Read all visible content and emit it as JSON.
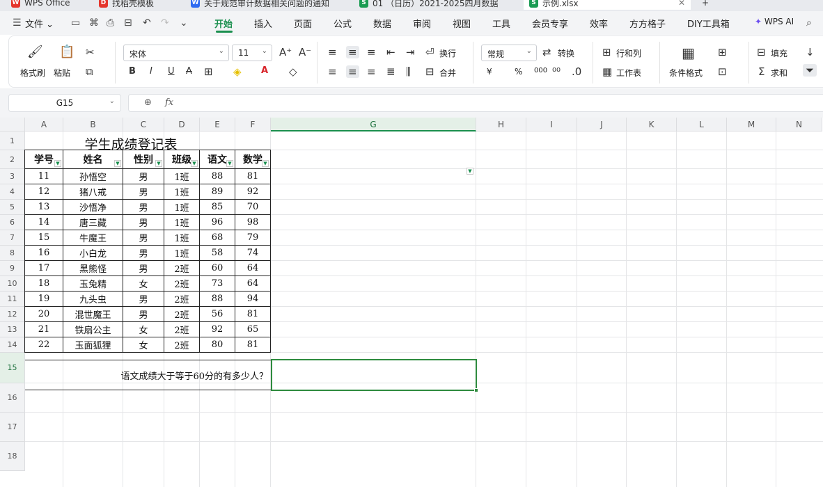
{
  "tabs": [
    {
      "label": "WPS Office",
      "icon": "W",
      "color": "#e5352c"
    },
    {
      "label": "找稻壳模板",
      "icon": "D",
      "color": "#e5352c"
    },
    {
      "label": "关于规范审计数据相关问题的通知",
      "icon": "W",
      "color": "#2f6bf1"
    },
    {
      "label": "01 （日历）2021-2025四月数据",
      "icon": "S",
      "color": "#1a9b52"
    },
    {
      "label": "示例.xlsx",
      "icon": "S",
      "color": "#1a9b52"
    }
  ],
  "menu": {
    "file_label": "文件",
    "items": [
      "开始",
      "插入",
      "页面",
      "公式",
      "数据",
      "审阅",
      "视图",
      "工具",
      "会员专享",
      "效率",
      "方方格子",
      "DIY工具箱"
    ],
    "active": "开始",
    "ai_label": "WPS AI"
  },
  "ribbon": {
    "format_painter": "格式刷",
    "paste": "粘贴",
    "font_name": "宋体",
    "font_size": "11",
    "bold": "B",
    "italic": "I",
    "underline": "U",
    "strike": "A",
    "wrap": "换行",
    "merge": "合并",
    "number_format": "常规",
    "convert": "转换",
    "currency": "¥",
    "percent": "%",
    "thousands": "000",
    "rows_cols": "行和列",
    "worksheet": "工作表",
    "conditional_format": "条件格式",
    "fill": "填充",
    "sum": "求和"
  },
  "formula_bar": {
    "name_box": "G15",
    "fx_label": "fx",
    "formula": ""
  },
  "grid": {
    "columns": [
      "A",
      "B",
      "C",
      "D",
      "E",
      "F",
      "G",
      "H",
      "I",
      "J",
      "K",
      "L",
      "M",
      "N"
    ],
    "selected_column": "G",
    "rows": [
      "1",
      "2",
      "3",
      "4",
      "5",
      "6",
      "7",
      "8",
      "9",
      "10",
      "11",
      "12",
      "13",
      "14",
      "15",
      "16",
      "17",
      "18"
    ],
    "selected_row": "15"
  },
  "sheet": {
    "title": "学生成绩登记表",
    "headers": [
      "学号",
      "姓名",
      "性别",
      "班级",
      "语文",
      "数学"
    ],
    "data": [
      [
        "11",
        "孙悟空",
        "男",
        "1班",
        "88",
        "81"
      ],
      [
        "12",
        "猪八戒",
        "男",
        "1班",
        "89",
        "92"
      ],
      [
        "13",
        "沙悟净",
        "男",
        "1班",
        "85",
        "70"
      ],
      [
        "14",
        "唐三藏",
        "男",
        "1班",
        "96",
        "98"
      ],
      [
        "15",
        "牛魔王",
        "男",
        "1班",
        "68",
        "79"
      ],
      [
        "16",
        "小白龙",
        "男",
        "1班",
        "58",
        "74"
      ],
      [
        "17",
        "黑熊怪",
        "男",
        "2班",
        "60",
        "64"
      ],
      [
        "18",
        "玉兔精",
        "女",
        "2班",
        "73",
        "64"
      ],
      [
        "19",
        "九头虫",
        "男",
        "2班",
        "88",
        "94"
      ],
      [
        "20",
        "混世魔王",
        "男",
        "2班",
        "56",
        "81"
      ],
      [
        "21",
        "铁扇公主",
        "女",
        "2班",
        "92",
        "65"
      ],
      [
        "22",
        "玉面狐狸",
        "女",
        "2班",
        "80",
        "81"
      ]
    ],
    "question": "语文成绩大于等于60分的有多少人？"
  }
}
